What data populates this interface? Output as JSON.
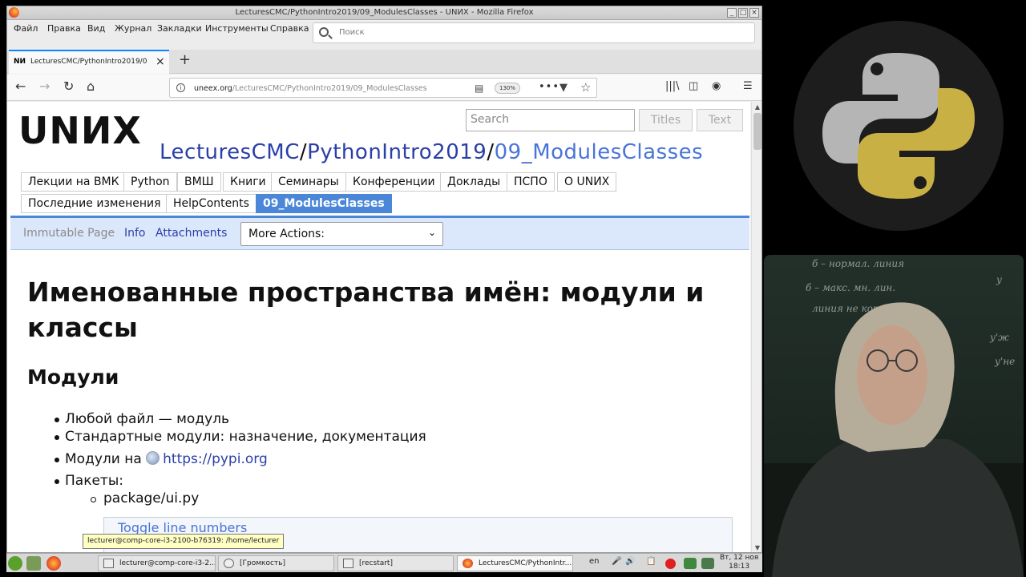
{
  "window": {
    "title": "LecturesCMC/PythonIntro2019/09_ModulesClasses - UNИX - Mozilla Firefox",
    "controls": [
      "_",
      "□",
      "×"
    ]
  },
  "menubar": {
    "items": [
      "Файл",
      "Правка",
      "Вид",
      "Журнал",
      "Закладки",
      "Инструменты",
      "Справка"
    ],
    "search_placeholder": "Поиск"
  },
  "tab": {
    "favicon_text": "NИ",
    "label": "LecturesCMC/PythonIntro2019/0",
    "close": "×",
    "new_tab": "+"
  },
  "navbar": {
    "url_host": "uneex.org",
    "url_path": "/LecturesCMC/PythonIntro2019/09_ModulesClasses",
    "zoom": "130%",
    "more": "•••"
  },
  "wiki": {
    "logo": "UNИX",
    "search_placeholder": "Search",
    "titles_button": "Titles",
    "text_button": "Text",
    "breadcrumb": {
      "part1": "LecturesCMC",
      "sep1": "/",
      "part2": "PythonIntro2019",
      "sep2": "/",
      "current": "09_ModulesClasses"
    },
    "tabs_row1": [
      "Лекции на ВМК",
      "Python",
      "ВМШ",
      "Книги",
      "Семинары",
      "Конференции",
      "Доклады",
      "ПСПО",
      "О UNИX"
    ],
    "tabs_row2": [
      "Последние изменения",
      "HelpContents",
      "09_ModulesClasses"
    ],
    "actions": {
      "immutable": "Immutable Page",
      "info": "Info",
      "attachments": "Attachments",
      "more_actions": "More Actions:"
    }
  },
  "content": {
    "title": "Именованные пространства имён: модули и классы",
    "section": "Модули",
    "items": [
      "Любой файл — модуль",
      "Стандартные модули: назначение, документация",
      "Модули на",
      "Пакеты:"
    ],
    "pypi_link": "https://pypi.org",
    "subitem": "package/ui.py",
    "toggle_line_numbers": "Toggle line numbers"
  },
  "tooltip": "lecturer@comp-core-i3-2100-b76319: /home/lecturer",
  "taskbar": {
    "tasks": [
      "lecturer@comp-core-i3-2...",
      "[Громкость]",
      "[recstart]",
      "LecturesCMC/PythonIntr..."
    ],
    "lang": "en",
    "clock_day": "Вт, 12 ноя",
    "clock_time": "18:13"
  },
  "video": {
    "chalk_lines": [
      "б – нормал. линия",
      "б – макс. мн. лин.",
      "линия не котор.",
      "у",
      "у'ж",
      "у'не"
    ]
  },
  "colors": {
    "link": "#2a3fa8",
    "active_tab": "#4b87d9",
    "action_bar": "#dbe8fb",
    "firefox_accent": "#0a84ff"
  }
}
